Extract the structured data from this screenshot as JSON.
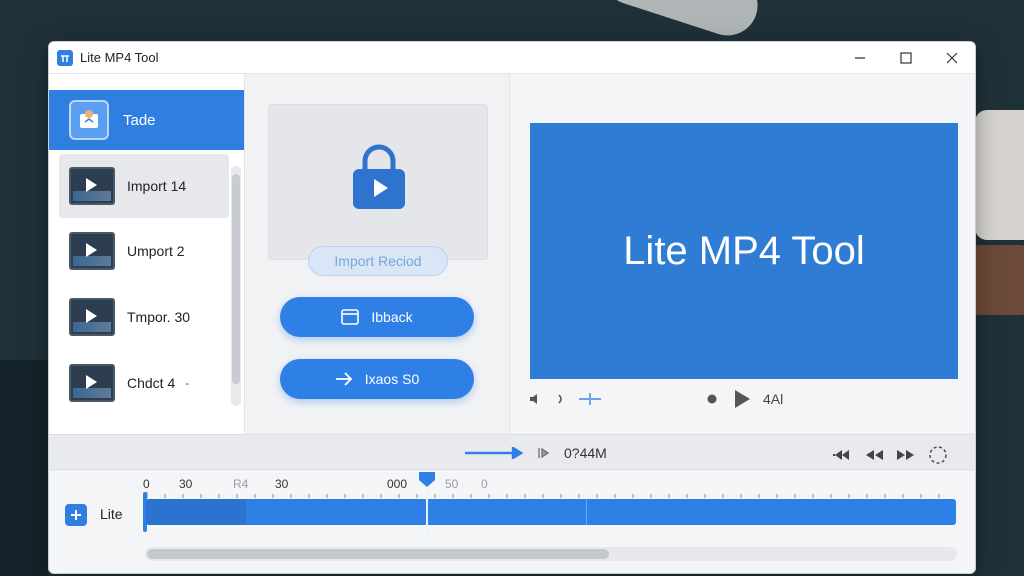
{
  "window": {
    "title": "Lite MP4 Tool"
  },
  "sidebar": {
    "header_label": "Tade",
    "items": [
      {
        "label": "Import 14"
      },
      {
        "label": "Umport 2"
      },
      {
        "label": "Tmpor. 30"
      },
      {
        "label": "Chdct 4"
      }
    ]
  },
  "middle": {
    "import_record_label": "Import Reciod",
    "back_label": "Ibback",
    "export_label": "Ixaos S0"
  },
  "preview": {
    "title": "Lite MP4 Tool",
    "time": "4Al"
  },
  "transport": {
    "time": "0?44M"
  },
  "timeline": {
    "ticks": [
      "0",
      "30",
      "R4",
      "30",
      "000",
      "50",
      "0"
    ],
    "track_label": "Lite"
  },
  "colors": {
    "accent": "#2f80e6",
    "preview_bg": "#2f7cd4"
  }
}
